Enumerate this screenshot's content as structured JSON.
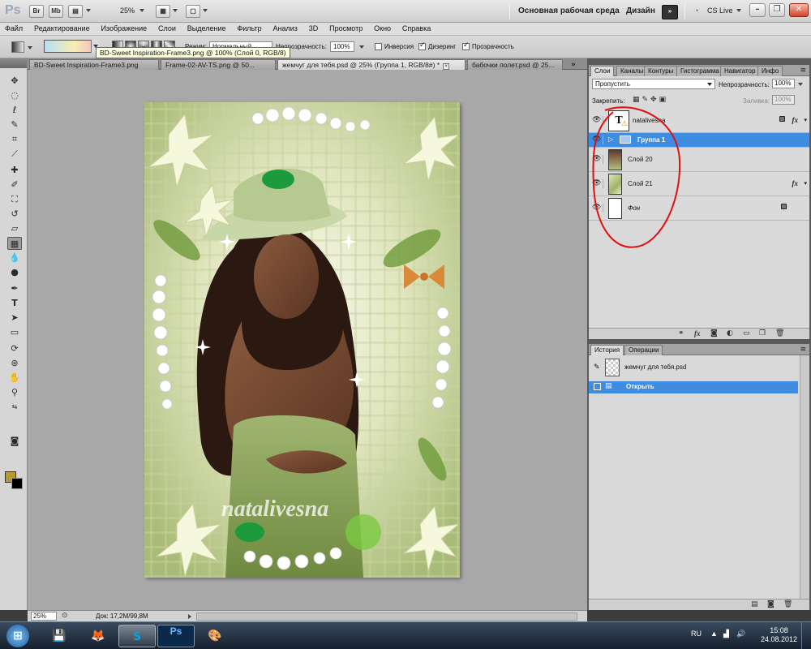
{
  "app": {
    "logo": "Ps",
    "topbar": {
      "bridge_label": "Br",
      "minibridge_label": "Mb",
      "zoom": "25%",
      "workspace_standard": "Основная рабочая среда",
      "workspace_design": "Дизайн",
      "cslive": "CS Live"
    }
  },
  "menu": [
    "Файл",
    "Редактирование",
    "Изображение",
    "Слои",
    "Выделение",
    "Фильтр",
    "Анализ",
    "3D",
    "Просмотр",
    "Окно",
    "Справка"
  ],
  "options": {
    "mode_label": "Режим:",
    "mode_value": "Нормальный",
    "opacity_label": "Непрозрачность:",
    "opacity_value": "100%",
    "inverse": "Инверсия",
    "dither": "Дизеринг",
    "transparency": "Прозрачность",
    "inverse_checked": false,
    "dither_checked": true,
    "transparency_checked": true,
    "gradient_colors": [
      "#b7ddf4",
      "#f7efb2",
      "#f4b3c0"
    ]
  },
  "tooltip": "BD-Sweet Inspiration-Frame3.png @ 100% (Слой 0, RGB/8)",
  "doc_tabs": [
    {
      "label": "BD-Sweet Inspiration-Frame3.png",
      "active": false
    },
    {
      "label": "Frame-02-AV-TS.png @ 50...",
      "active": false
    },
    {
      "label": "жемчуг для тебя.psd @ 25% (Группа 1, RGB/8#) *",
      "active": true
    },
    {
      "label": "бабочки полет.psd @ 25...",
      "active": false
    }
  ],
  "canvas": {
    "watermark": "natalivesna",
    "background": "#a8a8a8"
  },
  "status": {
    "zoom": "25%",
    "doc": "Док: 17,2M/99,8M"
  },
  "layers_panel": {
    "tabs": [
      "Слои",
      "Каналы",
      "Контуры",
      "Гистограмма",
      "Навигатор",
      "Инфо"
    ],
    "blend_mode": "Пропустить",
    "opacity_label": "Непрозрачность:",
    "opacity": "100%",
    "lock_label": "Закрепить:",
    "fill_label": "Заливка:",
    "fill": "100%",
    "layers": [
      {
        "name": "natalivesna",
        "type": "text",
        "fx": true,
        "locked": true,
        "selected": false
      },
      {
        "name": "Группа 1",
        "type": "group",
        "fx": false,
        "locked": false,
        "selected": true
      },
      {
        "name": "Слой 20",
        "type": "image",
        "fx": false,
        "locked": false,
        "selected": false
      },
      {
        "name": "Слой 21",
        "type": "image",
        "fx": true,
        "locked": false,
        "selected": false
      },
      {
        "name": "Фон",
        "type": "background",
        "fx": false,
        "locked": true,
        "selected": false
      }
    ]
  },
  "history_panel": {
    "tabs": [
      "История",
      "Операции"
    ],
    "snapshot": "жемчуг для тебя.psd",
    "states": [
      {
        "label": "Открыть",
        "selected": true
      }
    ]
  },
  "taskbar": {
    "lang": "RU",
    "time": "15:08",
    "date": "24.08.2012"
  },
  "colors": {
    "accent_selection": "#3e8de0",
    "foreground_swatch": "#b59b2e",
    "background_swatch": "#000000",
    "annotation_red": "#e01010"
  }
}
